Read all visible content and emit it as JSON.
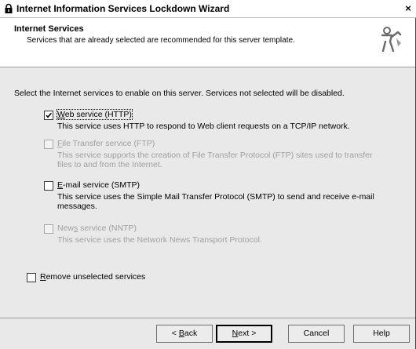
{
  "window": {
    "title": "Internet Information Services Lockdown Wizard",
    "close_label": "×"
  },
  "header": {
    "title": "Internet Services",
    "subtitle": "Services that are already selected are recommended for this server template."
  },
  "intro": "Select the Internet services to enable on this server. Services not selected will be disabled.",
  "services": [
    {
      "label_underline": "W",
      "label_rest": "eb service (HTTP)",
      "checked": true,
      "enabled": true,
      "description": "This service uses HTTP to respond to Web client requests on a TCP/IP network."
    },
    {
      "label_underline": "F",
      "label_rest": "ile Transfer service (FTP)",
      "checked": false,
      "enabled": false,
      "description": "This service supports the creation of File Transfer Protocol (FTP) sites used to transfer files to and from the Internet."
    },
    {
      "label_underline": "E",
      "label_rest": "-mail service (SMTP)",
      "checked": false,
      "enabled": true,
      "description": "This service uses the Simple Mail Transfer Protocol (SMTP) to send and receive e-mail messages."
    },
    {
      "label_prefix": "New",
      "label_underline": "s",
      "label_rest": " service (NNTP)",
      "checked": false,
      "enabled": false,
      "description": "This service uses the Network News Transport Protocol."
    }
  ],
  "remove_unselected": {
    "label_underline": "R",
    "label_rest": "emove unselected services",
    "checked": false
  },
  "buttons": {
    "back": {
      "pre": "< ",
      "underline": "B",
      "rest": "ack"
    },
    "next": {
      "underline": "N",
      "rest": "ext >"
    },
    "cancel": "Cancel",
    "help": "Help"
  },
  "icons": {
    "title": "lock-icon",
    "header": "wizard-figure-icon",
    "check": "checkmark-icon"
  },
  "colors": {
    "dialog_bg": "#e9e9e9",
    "disabled_text": "#a0a0a0"
  }
}
